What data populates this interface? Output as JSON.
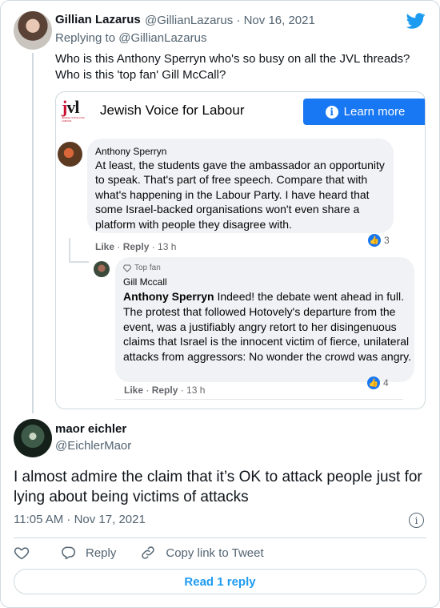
{
  "tweet1": {
    "name": "Gillian Lazarus",
    "handle_date": "@GillianLazarus · Nov 16, 2021",
    "replying_to": "Replying to @GillianLazarus",
    "line1": "Who is this Anthony Sperryn who's so busy on all the JVL threads?",
    "line2": "Who is this 'top fan' Gill McCall?"
  },
  "embed": {
    "logo_text": "jvl",
    "logo_sub": "JEWISH VOICE FOR LABOUR",
    "page_name": "Jewish Voice for Labour",
    "learn_more": "Learn more",
    "comment1": {
      "author": "Anthony Sperryn",
      "text": "At least, the students gave the ambassador an opportunity to speak. That's part of free speech. Compare that with what's happening in the Labour Party. I have heard that some Israel-backed organisations won't even share a platform with people they disagree with.",
      "like": "Like",
      "reply": "Reply",
      "age": "13 h",
      "reactions": "3"
    },
    "comment2": {
      "badge": "Top fan",
      "author": "Gill Mccall",
      "mention": "Anthony Sperryn",
      "text": " Indeed! the debate went ahead in full. The protest that followed Hotovely's departure from the event, was a justifiably angry retort to her disingenuous claims that Israel is the innocent victim of fierce, unilateral attacks from aggressors: No wonder the crowd was angry.",
      "like": "Like",
      "reply": "Reply",
      "age": "13 h",
      "reactions": "4"
    }
  },
  "tweet2": {
    "name": "maor eichler",
    "handle": "@EichlerMaor",
    "text": "I almost admire the claim that it’s OK to attack people just for lying about being victims of attacks",
    "timestamp": "11:05 AM · Nov 17, 2021"
  },
  "actions": {
    "reply": "Reply",
    "copy_link": "Copy link to Tweet",
    "read_replies": "Read 1 reply"
  },
  "colors": {
    "twitter_blue": "#1d9bf0",
    "facebook_blue": "#1877f2",
    "jvl_red": "#c8102e"
  }
}
